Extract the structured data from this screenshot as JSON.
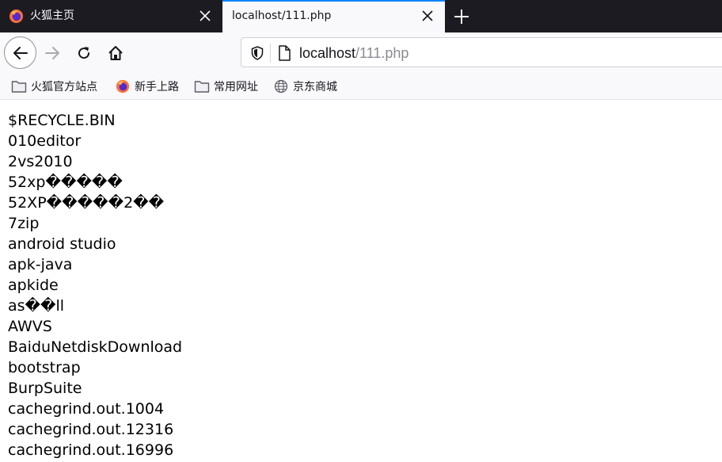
{
  "tabs": [
    {
      "title": "火狐主页",
      "active": false
    },
    {
      "title": "localhost/111.php",
      "active": true
    }
  ],
  "urlbar": {
    "host": "localhost",
    "path": "/111.php"
  },
  "bookmarks": [
    {
      "label": "火狐官方站点",
      "icon": "folder-icon"
    },
    {
      "label": "新手上路",
      "icon": "firefox-icon"
    },
    {
      "label": "常用网址",
      "icon": "folder-icon"
    },
    {
      "label": "京东商城",
      "icon": "globe-icon"
    }
  ],
  "listing": [
    "$RECYCLE.BIN",
    "010editor",
    "2vs2010",
    "52xp�����",
    "52XP�����2��",
    "7zip",
    "android studio",
    "apk-java",
    "apkide",
    "as��ll",
    "AWVS",
    "BaiduNetdiskDownload",
    "bootstrap",
    "BurpSuite",
    "cachegrind.out.1004",
    "cachegrind.out.12316",
    "cachegrind.out.16996"
  ],
  "colors": {
    "accent": "#0a84ff",
    "tabstrip": "#1c1b22",
    "toolbar": "#f9f9fb"
  }
}
